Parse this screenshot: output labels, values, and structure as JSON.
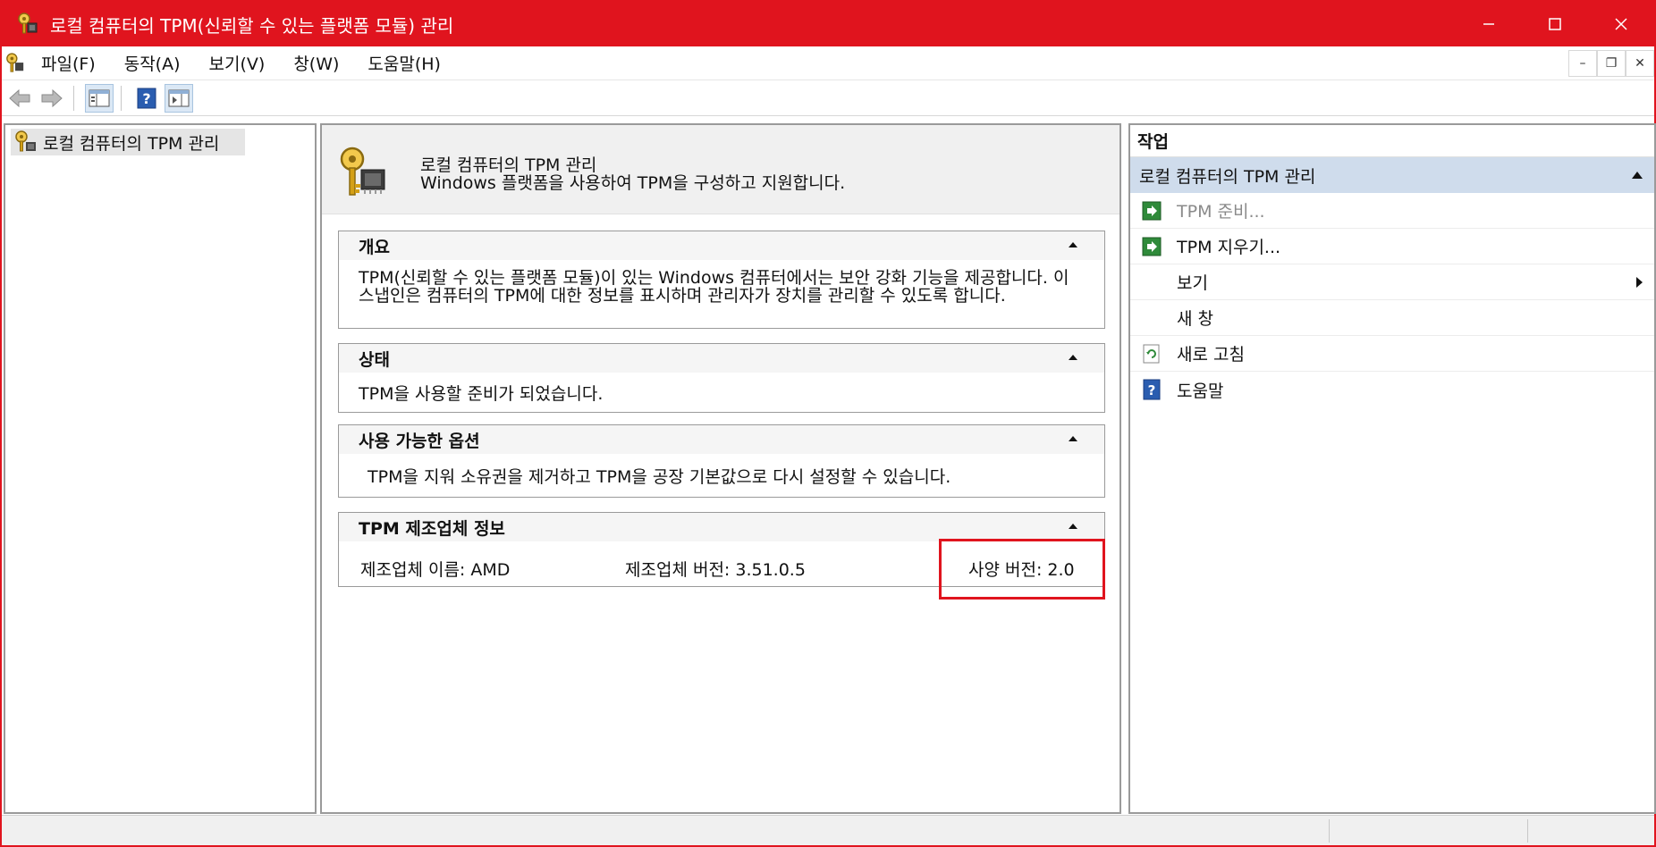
{
  "window": {
    "title": "로컬 컴퓨터의 TPM(신뢰할 수 있는 플랫폼 모듈) 관리",
    "accent_color": "#e0141e"
  },
  "menu": {
    "items": [
      "파일(F)",
      "동작(A)",
      "보기(V)",
      "창(W)",
      "도움말(H)"
    ]
  },
  "toolbar": {
    "icons": [
      "back-arrow-icon",
      "forward-arrow-icon",
      "show-hide-console-tree-icon",
      "help-icon",
      "show-hide-action-pane-icon"
    ]
  },
  "tree": {
    "root_label": "로컬 컴퓨터의 TPM 관리"
  },
  "center": {
    "header_title": "로컬 컴퓨터의 TPM 관리",
    "header_desc": "Windows 플랫폼을 사용하여 TPM을 구성하고 지원합니다.",
    "overview": {
      "title": "개요",
      "body": "TPM(신뢰할 수 있는 플랫폼 모듈)이 있는 Windows 컴퓨터에서는 보안 강화 기능을 제공합니다. 이 스냅인은 컴퓨터의 TPM에 대한 정보를 표시하며 관리자가 장치를 관리할 수 있도록 합니다."
    },
    "status": {
      "title": "상태",
      "body": "TPM을 사용할 준비가 되었습니다."
    },
    "options": {
      "title": "사용 가능한 옵션",
      "body": "TPM을 지워 소유권을 제거하고 TPM을 공장 기본값으로 다시 설정할 수 있습니다."
    },
    "manufacturer": {
      "title": "TPM 제조업체 정보",
      "name": "제조업체 이름: AMD",
      "version": "제조업체 버전: 3.51.0.5",
      "spec_version": "사양 버전: 2.0"
    }
  },
  "actions": {
    "title": "작업",
    "group_label": "로컬 컴퓨터의 TPM 관리",
    "items": [
      {
        "label": "TPM 준비...",
        "icon": "action-arrow-icon",
        "disabled": true
      },
      {
        "label": "TPM 지우기...",
        "icon": "action-arrow-icon",
        "disabled": false
      },
      {
        "label": "보기",
        "icon": "",
        "disabled": false
      },
      {
        "label": "새 창",
        "icon": "",
        "disabled": false
      },
      {
        "label": "새로 고침",
        "icon": "refresh-icon",
        "disabled": false
      },
      {
        "label": "도움말",
        "icon": "help-icon",
        "disabled": false
      }
    ]
  }
}
